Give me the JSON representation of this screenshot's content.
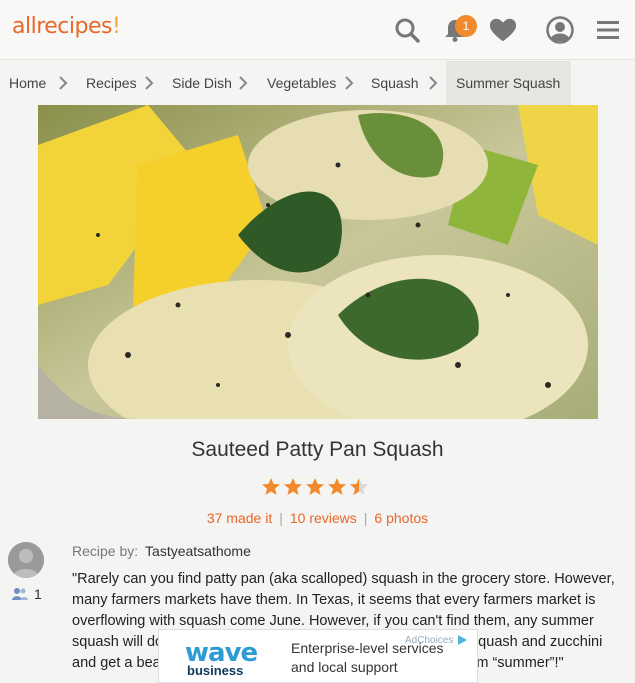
{
  "header": {
    "logo_main": "allrecipes",
    "logo_bang": "!",
    "notification_count": "1"
  },
  "breadcrumbs": [
    "Home",
    "Recipes",
    "Side Dish",
    "Vegetables",
    "Squash",
    "Summer Squash"
  ],
  "recipe": {
    "title": "Sauteed Patty Pan Squash",
    "rating": 4.5,
    "made_it": "37 made it",
    "reviews": "10 reviews",
    "photos": "6 photos",
    "stats_sep": "|",
    "recipe_by_label": "Recipe by:",
    "author": "Tastyeatsathome",
    "followers": "1",
    "description": "\"Rarely can you find patty pan (aka scalloped) squash in the grocery store. However, many farmers markets have them. In Texas, it seems that every farmers market is overflowing with squash come June. However, if you can't find them, any summer squash will do. Try using a mix of patty pan, crookneck yellow squash and zucchini and get a beautiful dish. The colors and fresh ingredients scream “summer”!\""
  },
  "ad": {
    "brand": "wave",
    "brand_sub": "business",
    "line1": "Enterprise-level services",
    "line2": "and local support",
    "adchoices": "AdChoices"
  },
  "colors": {
    "accent": "#e8672a",
    "star": "#f08a2c",
    "ad_brand": "#2d9bd5"
  }
}
